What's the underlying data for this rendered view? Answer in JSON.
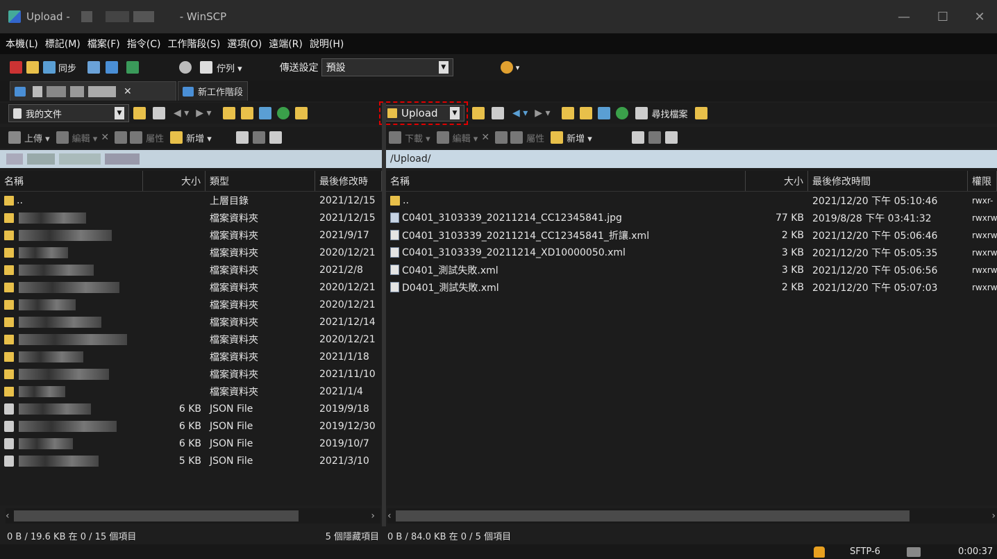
{
  "window": {
    "title_prefix": "Upload -",
    "title_suffix": "- WinSCP",
    "minimize": "—",
    "maximize": "☐",
    "close": "✕"
  },
  "menu": [
    "本機(L)",
    "標記(M)",
    "檔案(F)",
    "指令(C)",
    "工作階段(S)",
    "選項(O)",
    "遠端(R)",
    "說明(H)"
  ],
  "toolbar": {
    "sync": "同步",
    "queue": "佇列 ▾",
    "transfer_label": "傳送設定",
    "transfer_value": "預設"
  },
  "tabs": {
    "new_session": "新工作階段",
    "close": "✕"
  },
  "left": {
    "location": "我的文件",
    "actions": {
      "upload": "上傳 ▾",
      "edit": "編輯 ▾",
      "properties": "屬性",
      "new": "新增 ▾"
    },
    "columns": [
      "名稱",
      "大小",
      "類型",
      "最後修改時"
    ],
    "rows": [
      {
        "name": "..",
        "size": "",
        "type": "上層目錄",
        "date": "2021/12/15",
        "icon": "up"
      },
      {
        "name": "",
        "size": "",
        "type": "檔案資料夾",
        "date": "2021/12/15",
        "icon": "folder"
      },
      {
        "name": "",
        "size": "",
        "type": "檔案資料夾",
        "date": "2021/9/17",
        "icon": "folder"
      },
      {
        "name": "",
        "size": "",
        "type": "檔案資料夾",
        "date": "2020/12/21",
        "icon": "folder"
      },
      {
        "name": "",
        "size": "",
        "type": "檔案資料夾",
        "date": "2021/2/8",
        "icon": "folder"
      },
      {
        "name": "",
        "size": "",
        "type": "檔案資料夾",
        "date": "2020/12/21",
        "icon": "folder"
      },
      {
        "name": "",
        "size": "",
        "type": "檔案資料夾",
        "date": "2020/12/21",
        "icon": "folder"
      },
      {
        "name": "",
        "size": "",
        "type": "檔案資料夾",
        "date": "2021/12/14",
        "icon": "folder"
      },
      {
        "name": "",
        "size": "",
        "type": "檔案資料夾",
        "date": "2020/12/21",
        "icon": "folder"
      },
      {
        "name": "",
        "size": "",
        "type": "檔案資料夾",
        "date": "2021/1/18",
        "icon": "folder"
      },
      {
        "name": "",
        "size": "",
        "type": "檔案資料夾",
        "date": "2021/11/10",
        "icon": "folder"
      },
      {
        "name": "",
        "size": "",
        "type": "檔案資料夾",
        "date": "2021/1/4",
        "icon": "folder"
      },
      {
        "name": "",
        "size": "6 KB",
        "type": "JSON File",
        "date": "2019/9/18",
        "icon": "json"
      },
      {
        "name": "",
        "size": "6 KB",
        "type": "JSON File",
        "date": "2019/12/30",
        "icon": "json"
      },
      {
        "name": "",
        "size": "6 KB",
        "type": "JSON File",
        "date": "2019/10/7",
        "icon": "json"
      },
      {
        "name": "",
        "size": "5 KB",
        "type": "JSON File",
        "date": "2021/3/10",
        "icon": "json"
      }
    ],
    "status": "0 B / 19.6 KB 在 0 / 15 個項目",
    "hidden": "5 個隱藏項目"
  },
  "right": {
    "location": "Upload",
    "find": "尋找檔案",
    "path": "/Upload/",
    "actions": {
      "download": "下載 ▾",
      "edit": "編輯 ▾",
      "properties": "屬性",
      "new": "新增 ▾"
    },
    "columns": [
      "名稱",
      "大小",
      "最後修改時間",
      "權限"
    ],
    "rows": [
      {
        "name": "..",
        "size": "",
        "date": "2021/12/20 下午 05:10:46",
        "perm": "rwxr-",
        "icon": "up"
      },
      {
        "name": "C0401_3103339_20211214_CC12345841.jpg",
        "size": "77 KB",
        "date": "2019/8/28 下午 03:41:32",
        "perm": "rwxrw",
        "icon": "file"
      },
      {
        "name": "C0401_3103339_20211214_CC12345841_折讓.xml",
        "size": "2 KB",
        "date": "2021/12/20 下午 05:06:46",
        "perm": "rwxrw",
        "icon": "xml"
      },
      {
        "name": "C0401_3103339_20211214_XD10000050.xml",
        "size": "3 KB",
        "date": "2021/12/20 下午 05:05:35",
        "perm": "rwxrw",
        "icon": "xml"
      },
      {
        "name": "C0401_測試失敗.xml",
        "size": "3 KB",
        "date": "2021/12/20 下午 05:06:56",
        "perm": "rwxrw",
        "icon": "xml"
      },
      {
        "name": "D0401_測試失敗.xml",
        "size": "2 KB",
        "date": "2021/12/20 下午 05:07:03",
        "perm": "rwxrw",
        "icon": "xml"
      }
    ],
    "status": "0 B / 84.0 KB 在 0 / 5 個項目"
  },
  "bottom": {
    "protocol": "SFTP-6",
    "time": "0:00:37"
  },
  "colors": {
    "folder": "#e8c04a",
    "path_bar": "#c8d8e4",
    "highlight": "#e00000"
  }
}
